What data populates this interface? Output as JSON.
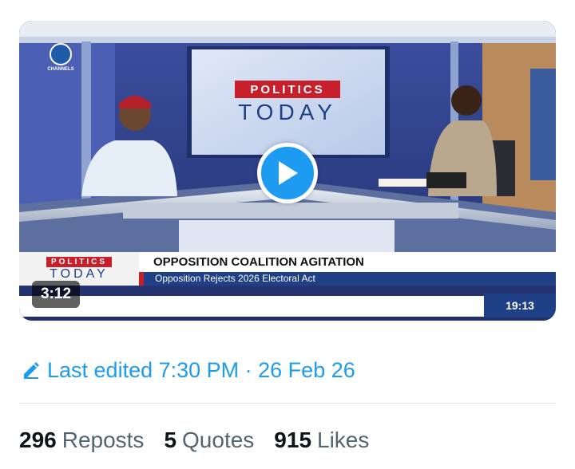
{
  "video": {
    "duration": "3:12",
    "channel_logo_text": "CHANNELS",
    "studio_screen": {
      "line1": "POLITICS",
      "line2": "TODAY"
    },
    "lower_third": {
      "logo_line1": "POLITICS",
      "logo_line2": "TODAY",
      "headline": "OPPOSITION COALITION AGITATION",
      "subheadline": "Opposition Rejects 2026 Electoral Act",
      "clock": "19:13"
    }
  },
  "edited": {
    "icon": "pencil-icon",
    "text": "Last edited 7:30 PM · 26 Feb 26"
  },
  "stats": {
    "reposts": {
      "count": "296",
      "label": "Reposts"
    },
    "quotes": {
      "count": "5",
      "label": "Quotes"
    },
    "likes": {
      "count": "915",
      "label": "Likes"
    }
  },
  "colors": {
    "accent": "#1d9bf0",
    "broadcast_blue": "#1f3f86",
    "broadcast_red": "#c8202a"
  }
}
